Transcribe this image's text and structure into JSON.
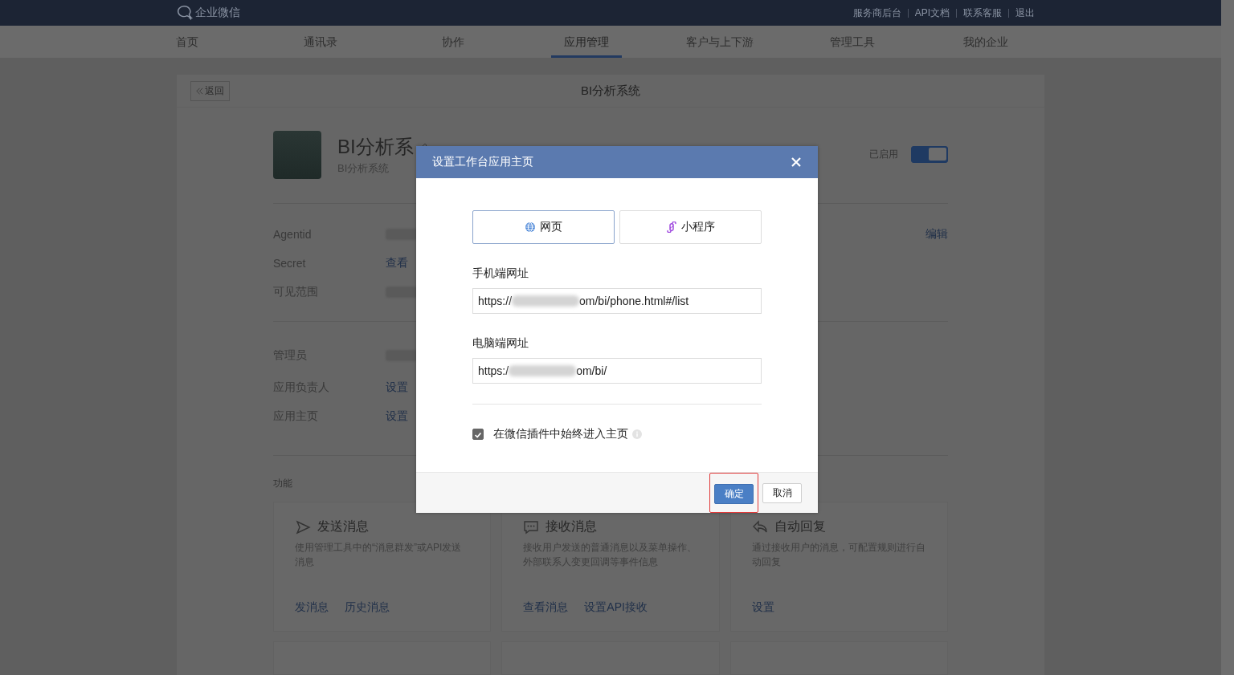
{
  "top_bar": {
    "logo_text": "企业微信",
    "links": [
      "服务商后台",
      "API文档",
      "联系客服",
      "退出"
    ]
  },
  "nav": {
    "items": [
      {
        "label": "首页",
        "selected": false
      },
      {
        "label": "通讯录",
        "selected": false
      },
      {
        "label": "协作",
        "selected": false
      },
      {
        "label": "应用管理",
        "selected": true
      },
      {
        "label": "客户与上下游",
        "selected": false
      },
      {
        "label": "管理工具",
        "selected": false
      },
      {
        "label": "我的企业",
        "selected": false
      }
    ]
  },
  "page": {
    "back_button": "返回",
    "title": "BI分析系统"
  },
  "app": {
    "name": "BI分析系",
    "subtitle": "BI分析系统",
    "status_label": "已启用",
    "enabled": true
  },
  "details": {
    "edit_link": "编辑",
    "rows": [
      {
        "label": "Agentid",
        "kind": "blurred"
      },
      {
        "label": "Secret",
        "kind": "link",
        "value": "查看"
      },
      {
        "label": "可见范围",
        "kind": "blurred"
      },
      {
        "label": "管理员",
        "kind": "blurred"
      },
      {
        "label": "应用负责人",
        "kind": "link",
        "value": "设置"
      },
      {
        "label": "应用主页",
        "kind": "link",
        "value": "设置"
      }
    ]
  },
  "features": {
    "section_label": "功能",
    "cards": [
      {
        "title": "发送消息",
        "description": "使用管理工具中的“消息群发”或API发送消息",
        "actions": [
          "发消息",
          "历史消息"
        ]
      },
      {
        "title": "接收消息",
        "description": "接收用户发送的普通消息以及菜单操作、外部联系人变更回调等事件信息",
        "actions": [
          "查看消息",
          "设置API接收"
        ]
      },
      {
        "title": "自动回复",
        "description": "通过接收用户的消息，可配置规则进行自动回复",
        "actions": [
          "设置"
        ]
      }
    ]
  },
  "modal": {
    "title": "设置工作台应用主页",
    "tabs": [
      {
        "label": "网页",
        "selected": true
      },
      {
        "label": "小程序",
        "selected": false
      }
    ],
    "fields": [
      {
        "label": "手机端网址",
        "value_start": "https://",
        "value_end": "om/bi/phone.html#/list"
      },
      {
        "label": "电脑端网址",
        "value_start": "https:/",
        "value_end": "om/bi/"
      }
    ],
    "option": {
      "label": "在微信插件中始终进入主页",
      "checked": true
    },
    "confirm_button": "确定",
    "confirm_highlighted": true,
    "cancel_button": "取消"
  }
}
